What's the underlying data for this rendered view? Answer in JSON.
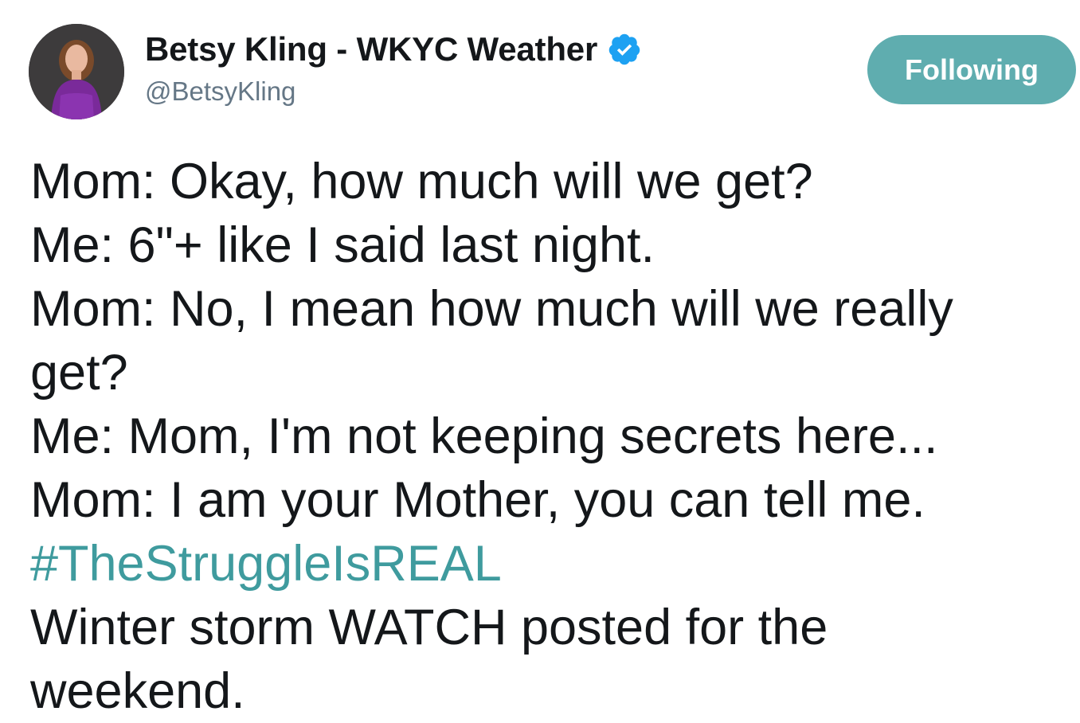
{
  "user": {
    "display_name": "Betsy Kling - WKYC Weather",
    "handle": "@BetsyKling",
    "avatar_icon": "profile-photo",
    "verified_icon": "verified-badge-icon"
  },
  "follow_button": {
    "label": "Following"
  },
  "tweet": {
    "lines": [
      "Mom: Okay, how much will we get?",
      "Me: 6\"+ like I said last night.",
      "Mom: No, I mean how much will we really",
      "get?",
      "Me: Mom, I'm not keeping secrets here...",
      "Mom: I am your Mother, you can tell me."
    ],
    "hashtag": "#TheStruggleIsREAL",
    "closing_lines": [
      "Winter storm WATCH posted for the",
      "weekend."
    ]
  },
  "colors": {
    "accent": "#5fadaf",
    "hashtag": "#3f9b9e",
    "verified": "#1da1f2",
    "text": "#14171a",
    "secondary": "#657786"
  }
}
